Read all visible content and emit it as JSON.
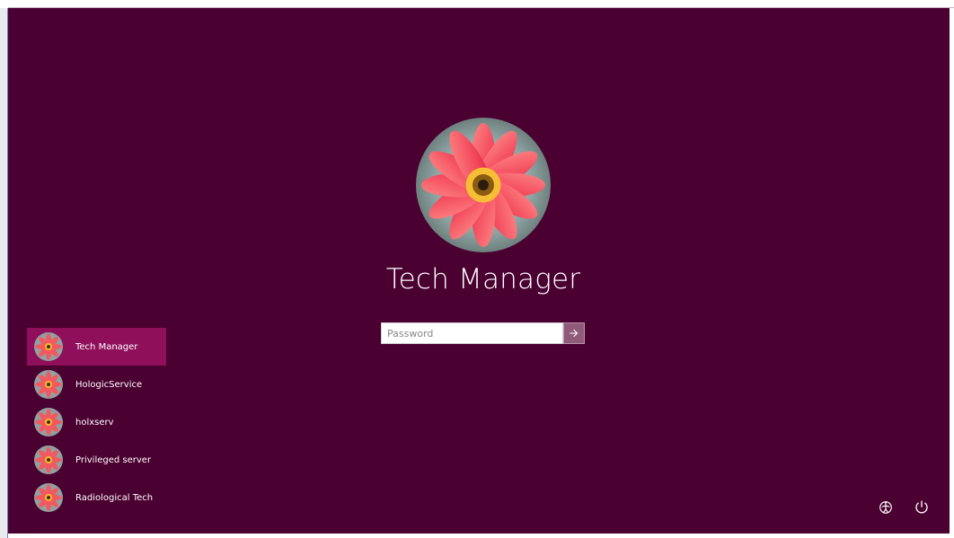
{
  "lockscreen": {
    "selected_user": "Tech Manager",
    "password": {
      "value": "",
      "placeholder": "Password"
    },
    "accounts": [
      {
        "label": "Tech Manager",
        "selected": true
      },
      {
        "label": "HologicService",
        "selected": false
      },
      {
        "label": "holxserv",
        "selected": false
      },
      {
        "label": "Privileged server",
        "selected": false
      },
      {
        "label": "Radiological Tech",
        "selected": false
      }
    ]
  },
  "icons": {
    "submit": "arrow-right-icon",
    "ease_of_access": "ease-of-access-icon",
    "power": "power-icon",
    "avatar": "flower-avatar-icon"
  },
  "colors": {
    "background": "#4a0031",
    "selected_account": "#8f0f5b",
    "submit_button": "#8f5b79",
    "text": "#ffffff"
  }
}
